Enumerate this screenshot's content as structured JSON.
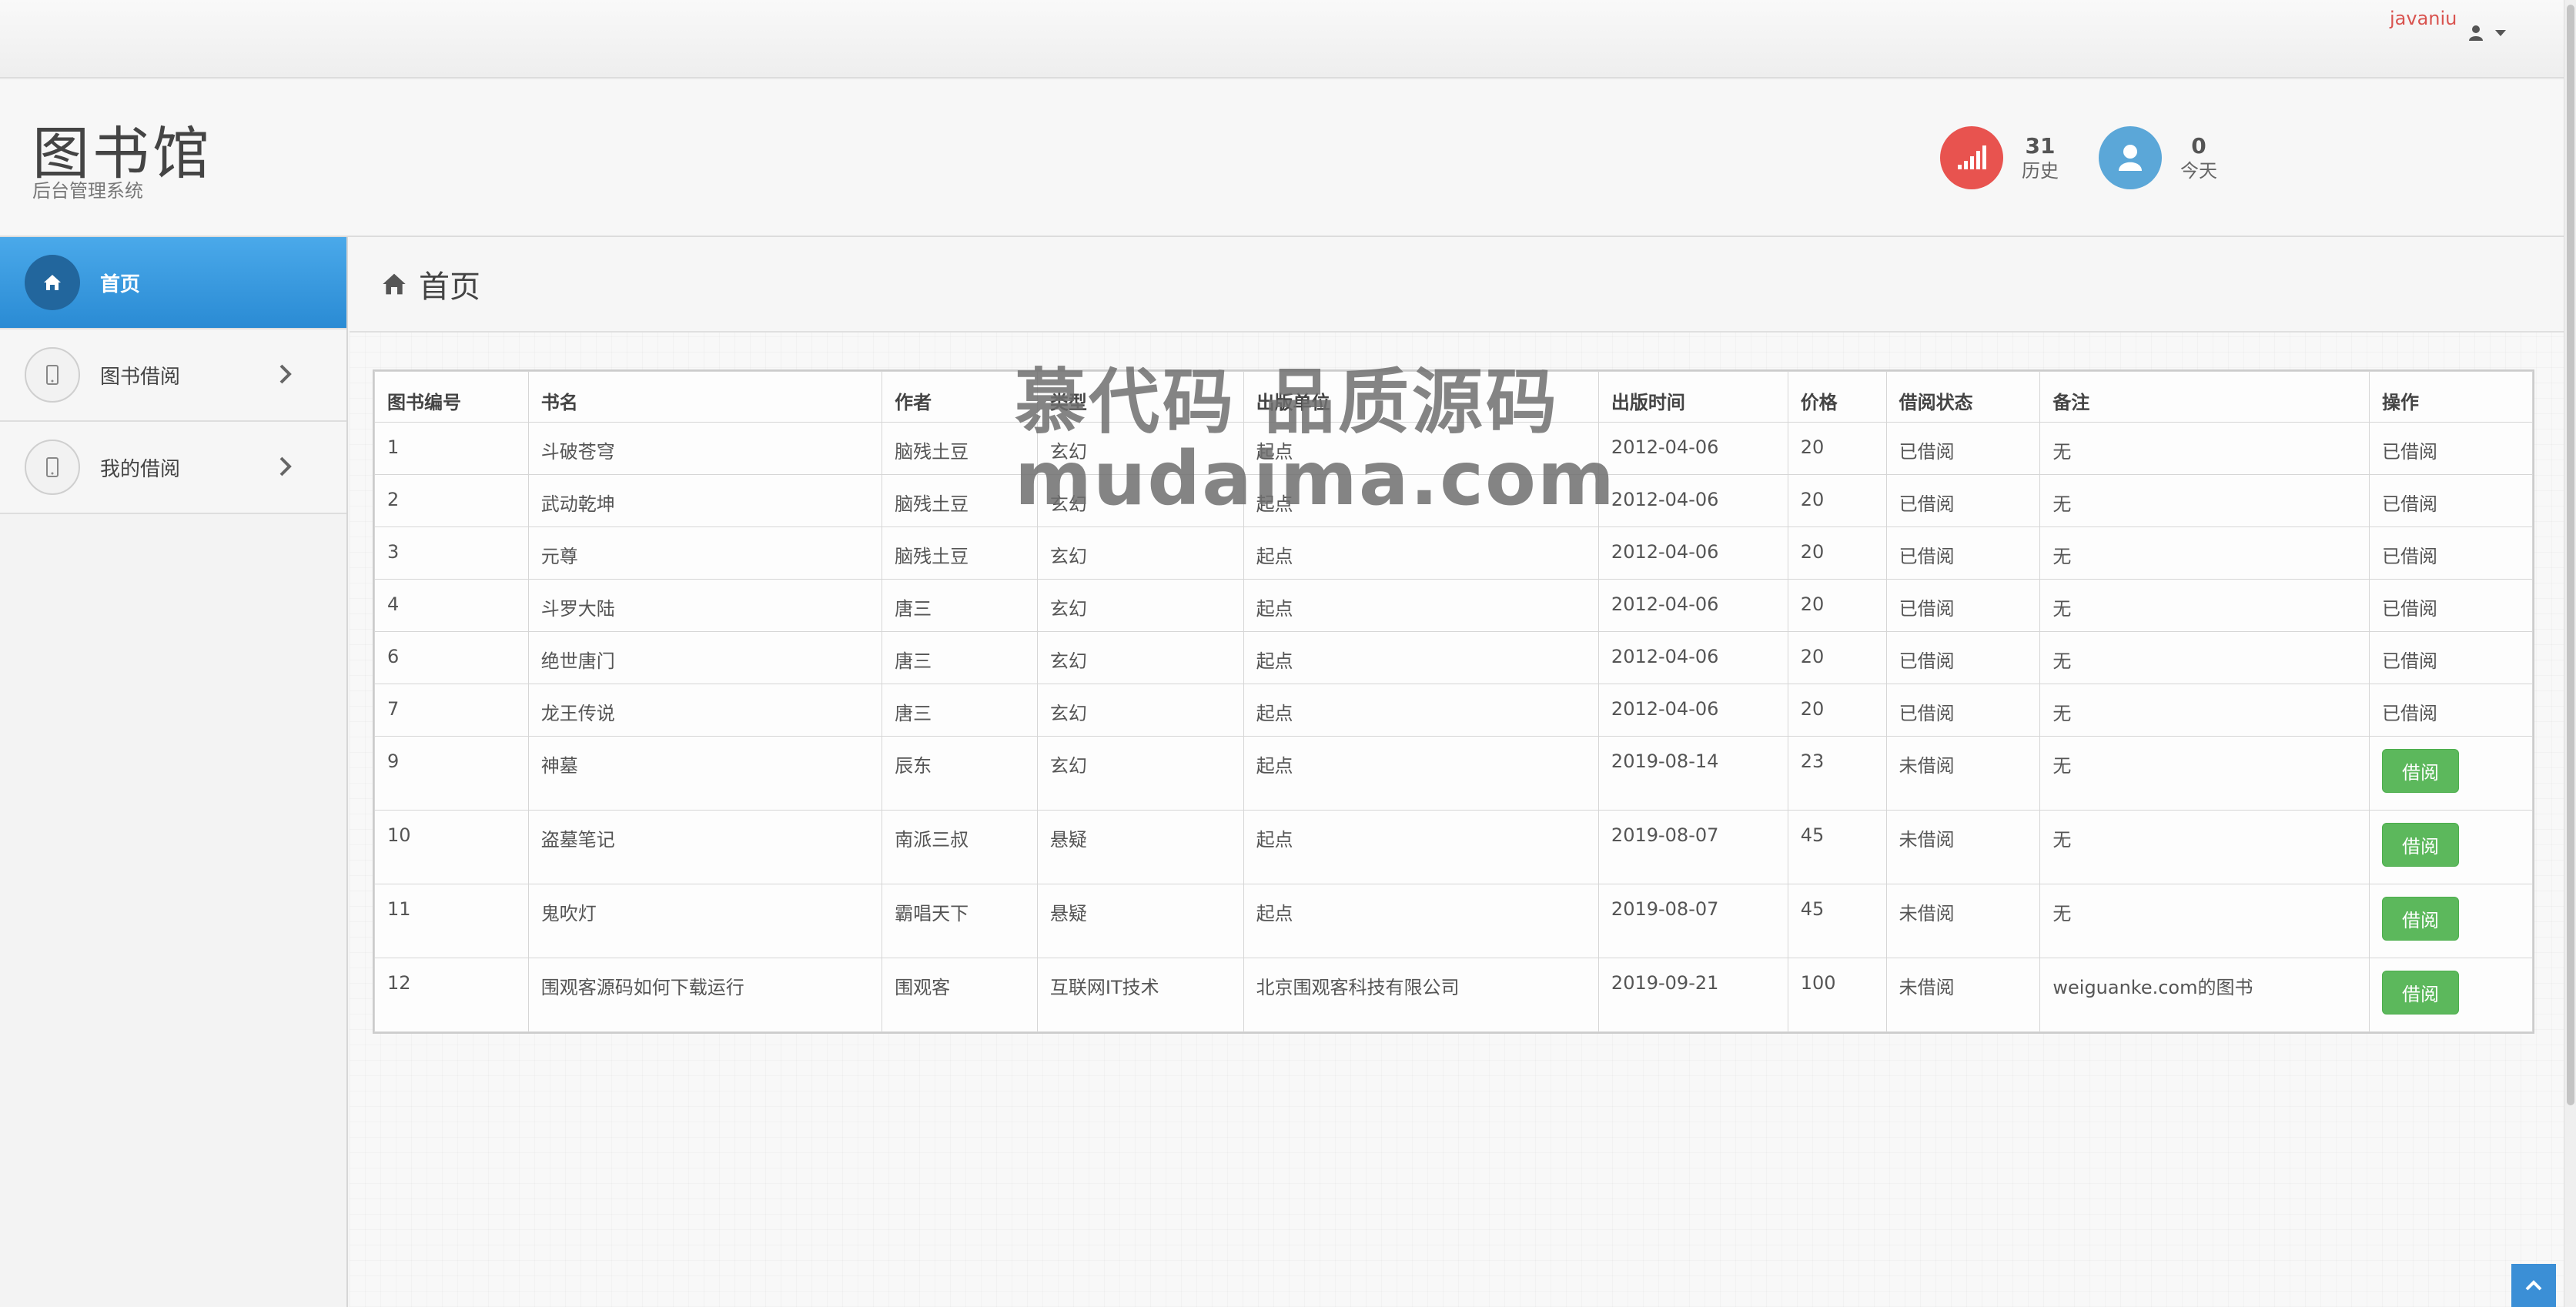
{
  "topbar": {
    "username": "javaniu"
  },
  "header": {
    "title": "图书馆",
    "subtitle": "后台管理系统",
    "stats": [
      {
        "value": "31",
        "label": "历史",
        "color": "#e8534f",
        "icon": "signal-bars-icon"
      },
      {
        "value": "0",
        "label": "今天",
        "color": "#5ba7d8",
        "icon": "user-icon"
      }
    ]
  },
  "sidebar": {
    "items": [
      {
        "label": "首页",
        "icon": "home-icon",
        "active": true
      },
      {
        "label": "图书借阅",
        "icon": "tablet-icon",
        "active": false
      },
      {
        "label": "我的借阅",
        "icon": "tablet-icon",
        "active": false
      }
    ]
  },
  "main": {
    "title": "首页",
    "table": {
      "columns": [
        "图书编号",
        "书名",
        "作者",
        "类型",
        "出版单位",
        "出版时间",
        "价格",
        "借阅状态",
        "备注",
        "操作"
      ],
      "rows": [
        {
          "id": "1",
          "name": "斗破苍穹",
          "author": "脑残土豆",
          "type": "玄幻",
          "publisher": "起点",
          "date": "2012-04-06",
          "price": "20",
          "status": "已借阅",
          "note": "无",
          "action": "已借阅"
        },
        {
          "id": "2",
          "name": "武动乾坤",
          "author": "脑残土豆",
          "type": "玄幻",
          "publisher": "起点",
          "date": "2012-04-06",
          "price": "20",
          "status": "已借阅",
          "note": "无",
          "action": "已借阅"
        },
        {
          "id": "3",
          "name": "元尊",
          "author": "脑残土豆",
          "type": "玄幻",
          "publisher": "起点",
          "date": "2012-04-06",
          "price": "20",
          "status": "已借阅",
          "note": "无",
          "action": "已借阅"
        },
        {
          "id": "4",
          "name": "斗罗大陆",
          "author": "唐三",
          "type": "玄幻",
          "publisher": "起点",
          "date": "2012-04-06",
          "price": "20",
          "status": "已借阅",
          "note": "无",
          "action": "已借阅"
        },
        {
          "id": "6",
          "name": "绝世唐门",
          "author": "唐三",
          "type": "玄幻",
          "publisher": "起点",
          "date": "2012-04-06",
          "price": "20",
          "status": "已借阅",
          "note": "无",
          "action": "已借阅"
        },
        {
          "id": "7",
          "name": "龙王传说",
          "author": "唐三",
          "type": "玄幻",
          "publisher": "起点",
          "date": "2012-04-06",
          "price": "20",
          "status": "已借阅",
          "note": "无",
          "action": "已借阅"
        },
        {
          "id": "9",
          "name": "神墓",
          "author": "辰东",
          "type": "玄幻",
          "publisher": "起点",
          "date": "2019-08-14",
          "price": "23",
          "status": "未借阅",
          "note": "无",
          "action": "借阅"
        },
        {
          "id": "10",
          "name": "盗墓笔记",
          "author": "南派三叔",
          "type": "悬疑",
          "publisher": "起点",
          "date": "2019-08-07",
          "price": "45",
          "status": "未借阅",
          "note": "无",
          "action": "借阅"
        },
        {
          "id": "11",
          "name": "鬼吹灯",
          "author": "霸唱天下",
          "type": "悬疑",
          "publisher": "起点",
          "date": "2019-08-07",
          "price": "45",
          "status": "未借阅",
          "note": "无",
          "action": "借阅"
        },
        {
          "id": "12",
          "name": "围观客源码如何下载运行",
          "author": "围观客",
          "type": "互联网IT技术",
          "publisher": "北京围观客科技有限公司",
          "date": "2019-09-21",
          "price": "100",
          "status": "未借阅",
          "note": "weiguanke.com的图书",
          "action": "借阅"
        }
      ]
    }
  },
  "watermark": {
    "line1": "慕代码 品质源码",
    "line2": "mudaima.com"
  },
  "colors": {
    "accent": "#2a8bd4",
    "success": "#5cb85c",
    "danger": "#d9534f"
  }
}
